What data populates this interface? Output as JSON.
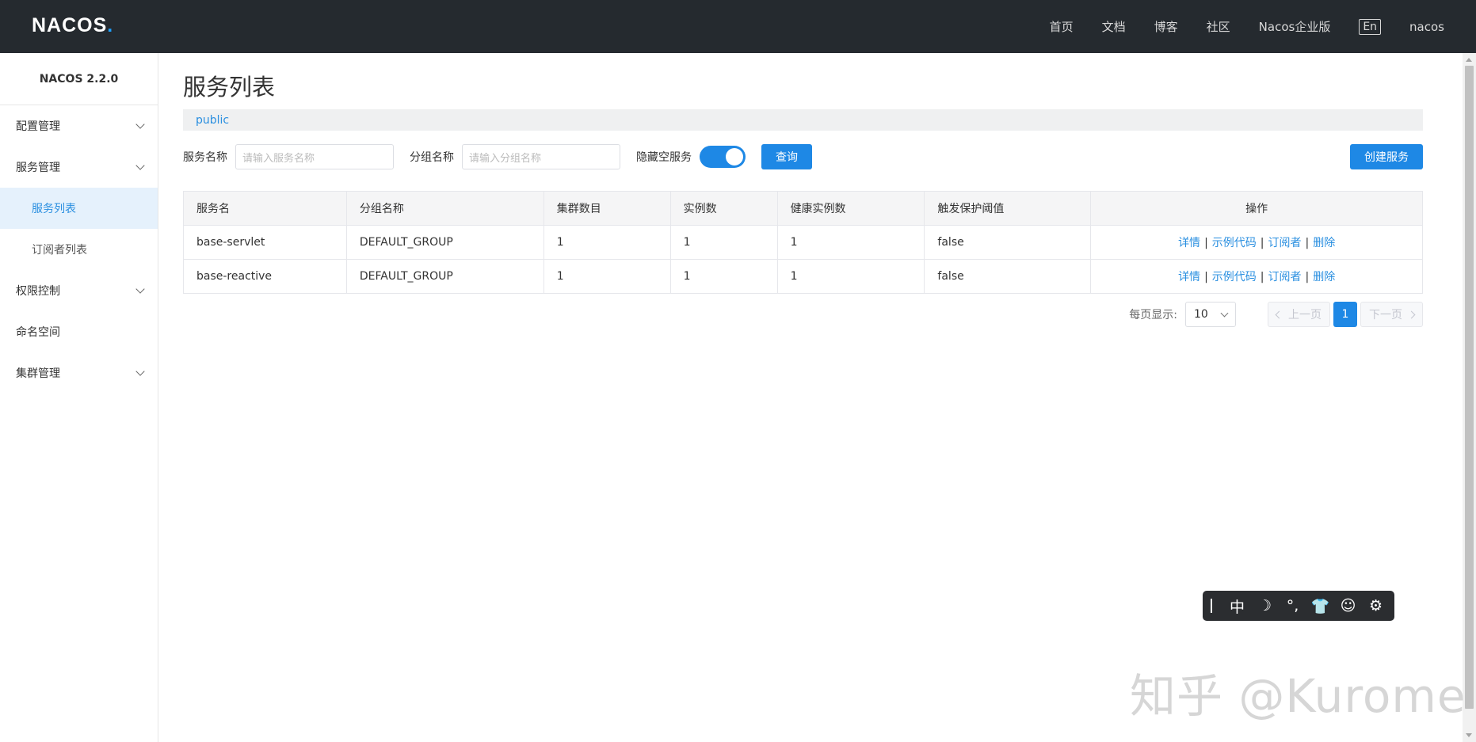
{
  "header": {
    "logo": "NACOS",
    "logo_dot": ".",
    "nav": [
      "首页",
      "文档",
      "博客",
      "社区",
      "Nacos企业版"
    ],
    "lang": "En",
    "user": "nacos"
  },
  "sidebar": {
    "version": "NACOS 2.2.0",
    "items": [
      {
        "label": "配置管理"
      },
      {
        "label": "服务管理"
      },
      {
        "label": "服务列表"
      },
      {
        "label": "订阅者列表"
      },
      {
        "label": "权限控制"
      },
      {
        "label": "命名空间"
      },
      {
        "label": "集群管理"
      }
    ]
  },
  "main": {
    "title": "服务列表",
    "namespace": "public",
    "search": {
      "service_label": "服务名称",
      "service_placeholder": "请输入服务名称",
      "group_label": "分组名称",
      "group_placeholder": "请输入分组名称",
      "hide_empty_label": "隐藏空服务",
      "hide_empty_on": true,
      "query_button": "查询",
      "create_button": "创建服务"
    },
    "table": {
      "columns": [
        "服务名",
        "分组名称",
        "集群数目",
        "实例数",
        "健康实例数",
        "触发保护阈值",
        "操作"
      ],
      "rows": [
        {
          "name": "base-servlet",
          "group": "DEFAULT_GROUP",
          "clusters": "1",
          "instances": "1",
          "healthy": "1",
          "threshold": "false"
        },
        {
          "name": "base-reactive",
          "group": "DEFAULT_GROUP",
          "clusters": "1",
          "instances": "1",
          "healthy": "1",
          "threshold": "false"
        }
      ],
      "ops": {
        "detail": "详情",
        "sample": "示例代码",
        "subscriber": "订阅者",
        "delete": "删除",
        "separator": "|"
      }
    },
    "pagination": {
      "page_size_label": "每页显示:",
      "page_size": "10",
      "prev": "上一页",
      "current": "1",
      "next": "下一页"
    }
  },
  "ime_toolbar": {
    "items": [
      "中",
      "☽",
      "°,",
      "👕",
      "☺",
      "⚙"
    ]
  },
  "watermark": "知乎 @Kurome"
}
